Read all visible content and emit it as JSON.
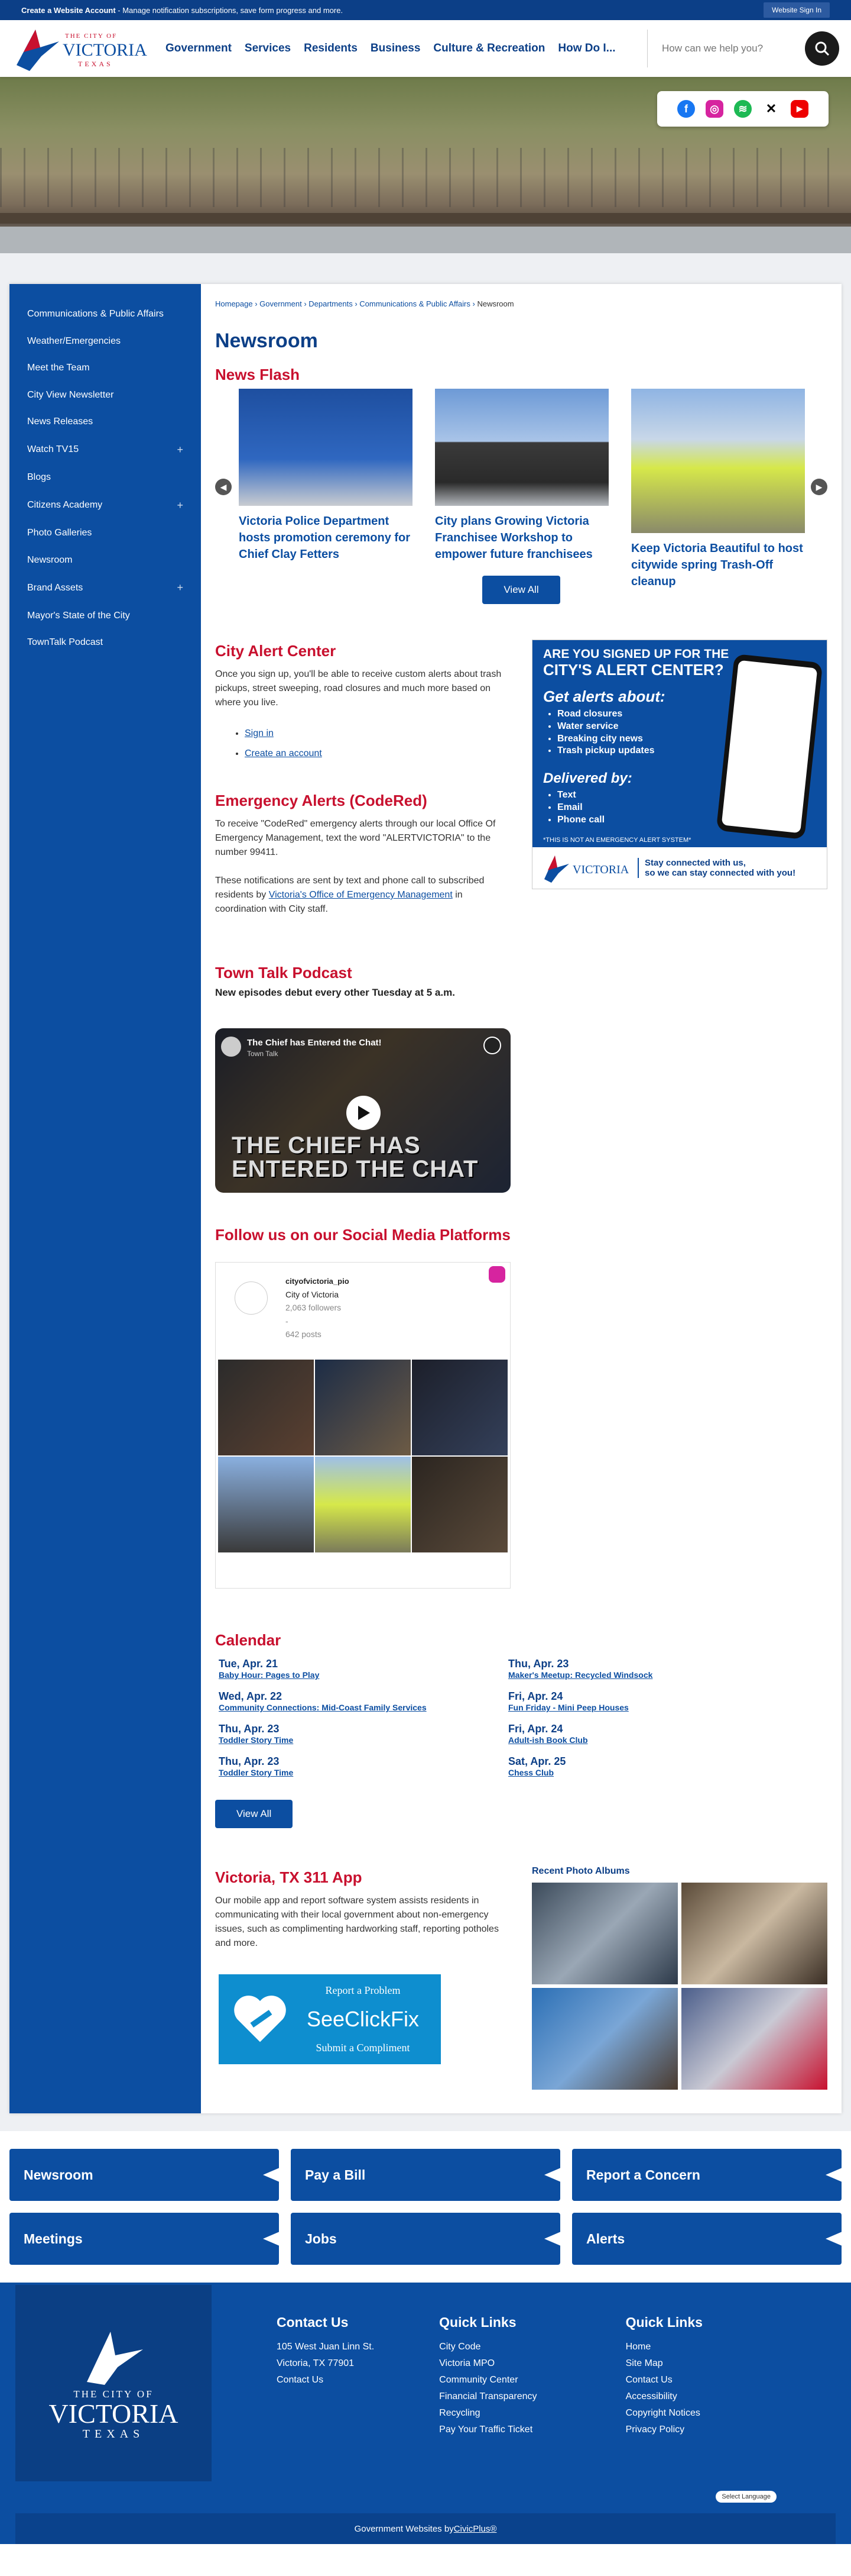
{
  "topbar": {
    "create_account": "Create a Website Account",
    "create_desc": " - Manage notification subscriptions, save form progress and more.",
    "sign_in": "Website Sign In"
  },
  "logo": {
    "line1": "THE CITY OF",
    "line2": "VICTORIA",
    "line3": "TEXAS"
  },
  "nav": [
    "Government",
    "Services",
    "Residents",
    "Business",
    "Culture & Recreation",
    "How Do I..."
  ],
  "search": {
    "placeholder": "How can we help you?"
  },
  "social_icons": [
    "facebook-icon",
    "instagram-icon",
    "spotify-icon",
    "x-icon",
    "youtube-icon"
  ],
  "sidebar": [
    {
      "label": "Communications & Public Affairs",
      "plus": ""
    },
    {
      "label": "Weather/Emergencies",
      "plus": ""
    },
    {
      "label": "Meet the Team",
      "plus": ""
    },
    {
      "label": "City View Newsletter",
      "plus": ""
    },
    {
      "label": "News Releases",
      "plus": ""
    },
    {
      "label": "Watch TV15",
      "plus": "+"
    },
    {
      "label": "Blogs",
      "plus": ""
    },
    {
      "label": "Citizens Academy",
      "plus": "+"
    },
    {
      "label": "Photo Galleries",
      "plus": ""
    },
    {
      "label": "Newsroom",
      "plus": ""
    },
    {
      "label": "Brand Assets",
      "plus": "+"
    },
    {
      "label": "Mayor's State of the City",
      "plus": ""
    },
    {
      "label": "TownTalk Podcast",
      "plus": ""
    }
  ],
  "breadcrumb": {
    "items": [
      "Homepage",
      "Government",
      "Departments",
      "Communications & Public Affairs"
    ],
    "current": "Newsroom",
    "sep": " › "
  },
  "page_title": "Newsroom",
  "news_flash": {
    "title": "News Flash",
    "cards": [
      {
        "title": "Victoria Police Department hosts promotion ceremony for Chief Clay Fetters"
      },
      {
        "title": "City plans Growing Victoria Franchisee Workshop to empower future franchisees"
      },
      {
        "title": "Keep Victoria Beautiful to host citywide spring Trash-Off cleanup"
      }
    ],
    "view_all": "View All"
  },
  "alert_center": {
    "title": "City Alert Center",
    "desc": "Once you sign up, you'll be able to receive custom alerts about trash pickups, street sweeping, road closures and much more based on where you live.",
    "links": [
      "Sign in",
      "Create an account"
    ],
    "graphic": {
      "headline1": "ARE YOU SIGNED UP FOR THE",
      "headline2": "CITY'S ALERT CENTER?",
      "get_alerts": "Get alerts about:",
      "alert_items": [
        "Road closures",
        "Water service",
        "Breaking city news",
        "Trash pickup updates"
      ],
      "delivered": "Delivered by:",
      "delivered_items": [
        "Text",
        "Email",
        "Phone call"
      ],
      "disclaimer": "*THIS IS NOT AN EMERGENCY ALERT SYSTEM*",
      "stay_connected": "Stay connected with us,",
      "stay_connected2": "so we can stay connected with you!"
    }
  },
  "emergency": {
    "title": "Emergency Alerts (CodeRed)",
    "p1": "To receive \"CodeRed\" emergency alerts through our local Office Of Emergency Management, text the word \"ALERTVICTORIA\" to the number 99411.",
    "p2_pre": "These notifications are sent by text and phone call to subscribed residents by ",
    "p2_link": "Victoria's Office of Emergency Management",
    "p2_post": " in coordination with City staff."
  },
  "podcast": {
    "title": "Town Talk Podcast",
    "subtitle": "New episodes debut every other Tuesday at 5 a.m.",
    "video_title": "The Chief has Entered the Chat!",
    "video_channel": "Town Talk",
    "video_caption1": "THE CHIEF HAS",
    "video_caption2": "ENTERED THE CHAT"
  },
  "social": {
    "title": "Follow us on our Social Media Platforms",
    "handle": "cityofvictoria_pio",
    "name": "City of Victoria",
    "followers": "2,063 followers",
    "dash": "-",
    "posts": "642 posts"
  },
  "calendar": {
    "title": "Calendar",
    "events": [
      {
        "date": "Tue, Apr. 21",
        "event": "Baby Hour: Pages to Play"
      },
      {
        "date": "Thu, Apr. 23",
        "event": "Maker's Meetup: Recycled Windsock"
      },
      {
        "date": "Wed, Apr. 22",
        "event": "Community Connections: Mid-Coast Family Services"
      },
      {
        "date": "Fri, Apr. 24",
        "event": "Fun Friday - Mini Peep Houses"
      },
      {
        "date": "Thu, Apr. 23",
        "event": "Toddler Story Time"
      },
      {
        "date": "Fri, Apr. 24",
        "event": "Adult-ish Book Club"
      },
      {
        "date": "Thu, Apr. 23",
        "event": "Toddler Story Time"
      },
      {
        "date": "Sat, Apr. 25",
        "event": "Chess Club"
      }
    ],
    "view_all": "View All"
  },
  "app311": {
    "title": "Victoria, TX 311 App",
    "desc": "Our mobile app and report software system assists residents in communicating with their local government about non-emergency issues, such as complimenting hardworking staff, reporting potholes and more.",
    "scf_report": "Report a Problem",
    "scf_name": "SeeClickFix",
    "scf_compliment": "Submit a Compliment"
  },
  "albums": {
    "title": "Recent Photo Albums"
  },
  "quick_buttons": [
    "Newsroom",
    "Pay a Bill",
    "Report a Concern",
    "Meetings",
    "Jobs",
    "Alerts"
  ],
  "footer": {
    "contact": {
      "title": "Contact Us",
      "lines": [
        "105 West Juan Linn St.",
        "Victoria, TX 77901",
        "Contact Us"
      ]
    },
    "quick1": {
      "title": "Quick Links",
      "lines": [
        "City Code",
        "Victoria MPO",
        "Community Center",
        "Financial Transparency",
        "Recycling",
        "Pay Your Traffic Ticket"
      ]
    },
    "quick2": {
      "title": "Quick Links",
      "lines": [
        "Home",
        "Site Map",
        "Contact Us",
        "Accessibility",
        "Copyright Notices",
        "Privacy Policy"
      ]
    },
    "language": "Select Language",
    "civic_pre": "Government Websites by ",
    "civic_link": "CivicPlus®"
  },
  "colors": {
    "primary": "#0c4ea1",
    "dark": "#0c3f87",
    "accent_red": "#c8102e"
  }
}
